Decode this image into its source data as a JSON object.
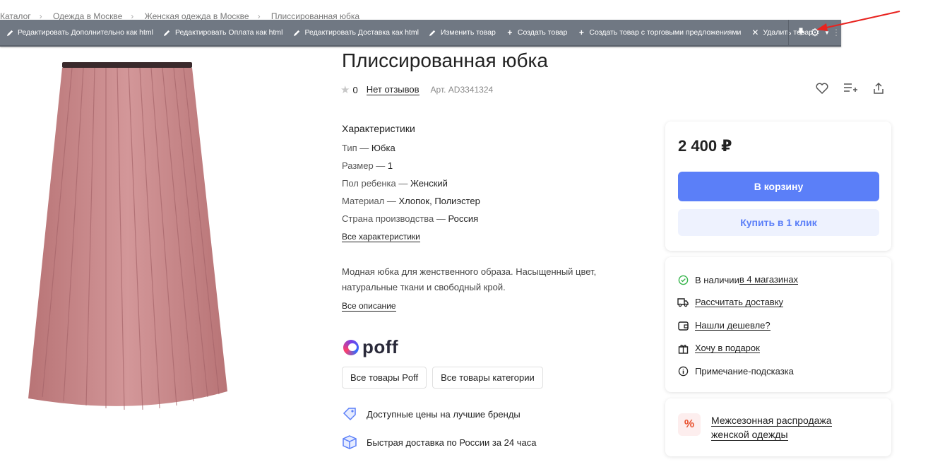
{
  "breadcrumb": [
    "Каталог",
    "Одежда в Москве",
    "Женская одежда в Москве",
    "Плиссированная юбка"
  ],
  "admin_bar": {
    "items": [
      {
        "label": "Редактировать Дополнительно как html",
        "icon": "pencil-icon"
      },
      {
        "label": "Редактировать Оплата как html",
        "icon": "pencil-icon"
      },
      {
        "label": "Редактировать Доставка как html",
        "icon": "pencil-icon"
      },
      {
        "label": "Изменить товар",
        "icon": "pencil-icon"
      },
      {
        "label": "Создать товар",
        "icon": "plus-icon"
      },
      {
        "label": "Создать товар с торговыми предложениями",
        "icon": "plus-icon"
      },
      {
        "label": "Удалить товар",
        "icon": "close-icon"
      }
    ],
    "right_icons": [
      "pin-icon",
      "gear-icon",
      "caret-down-icon",
      "grip-icon"
    ]
  },
  "product": {
    "title": "Плиссированная юбка",
    "rating": "0",
    "reviews_link": "Нет отзывов",
    "sku": "Арт. AD3341324",
    "image_color": "#c98b8d"
  },
  "characteristics": {
    "heading": "Характеристики",
    "rows": [
      {
        "key": "Тип — ",
        "value": "Юбка"
      },
      {
        "key": "Размер — ",
        "value": "1"
      },
      {
        "key": "Пол ребенка — ",
        "value": "Женский"
      },
      {
        "key": "Материал — ",
        "value": "Хлопок, Полиэстер"
      },
      {
        "key": "Страна производства — ",
        "value": "Россия"
      }
    ],
    "all_link": "Все характеристики"
  },
  "description": {
    "text": "Модная юбка для женственного образа. Насыщенный цвет, натуральные ткани и свободный крой.",
    "all_link": "Все описание"
  },
  "brand": {
    "name": "poff",
    "buttons": [
      "Все товары Poff",
      "Все товары категории"
    ]
  },
  "features": [
    {
      "label": "Доступные цены на лучшие бренды",
      "icon": "price-tag-icon"
    },
    {
      "label": "Быстрая доставка по России за 24 часа",
      "icon": "box-icon"
    }
  ],
  "buy": {
    "price": "2 400 ₽",
    "cart_button": "В корзину",
    "oneclick_button": "Купить в 1 клик",
    "accent": "#5b7ff8"
  },
  "info": {
    "stock_prefix": "В наличии ",
    "stock_link": "в 4 магазинах",
    "delivery": "Рассчитать доставку",
    "cheaper": "Нашли дешевле?",
    "gift": "Хочу в подарок",
    "note": "Примечание-подсказка"
  },
  "promo": {
    "icon": "%",
    "text": "Межсезонная распродажа женской одежды"
  }
}
